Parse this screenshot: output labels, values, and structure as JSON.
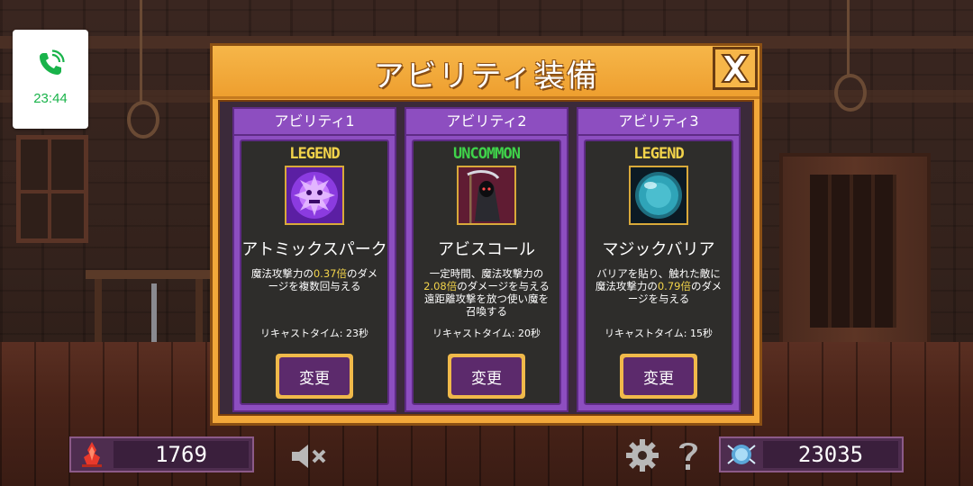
{
  "phone": {
    "time": "23:44",
    "icon": "phone-call-icon",
    "color": "#19b34a"
  },
  "dialog": {
    "title": "アビリティ装備",
    "close_icon": "close-x-icon",
    "slots": [
      {
        "label": "アビリティ1",
        "rarity": "LEGEND",
        "rarity_color": "#f2d34a",
        "icon": "atomic-spark-icon",
        "name": "アトミックスパーク",
        "desc_parts": [
          "魔法攻撃力の",
          "0.37倍",
          "のダメージを複数回与える"
        ],
        "recast": "リキャストタイム: 23秒",
        "button": "変更"
      },
      {
        "label": "アビリティ2",
        "rarity": "UNCOMMON",
        "rarity_color": "#3fd24a",
        "icon": "reaper-icon",
        "name": "アビスコール",
        "desc_parts": [
          "一定時間、魔法攻撃力の",
          "2.08倍",
          "のダメージを与える遠距離攻撃を放つ使い魔を召喚する"
        ],
        "recast": "リキャストタイム: 20秒",
        "button": "変更"
      },
      {
        "label": "アビリティ3",
        "rarity": "LEGEND",
        "rarity_color": "#f2d34a",
        "icon": "magic-barrier-orb-icon",
        "name": "マジックバリア",
        "desc_parts": [
          "バリアを貼り、触れた敵に魔法攻撃力の",
          "0.79倍",
          "のダメージを与える"
        ],
        "recast": "リキャストタイム: 15秒",
        "button": "変更"
      }
    ]
  },
  "hud": {
    "left_counter": {
      "icon": "red-flame-crystal-icon",
      "value": "1769"
    },
    "right_counter": {
      "icon": "blue-gem-orb-icon",
      "value": "23035"
    },
    "mute_icon": "speaker-muted-icon",
    "settings_icon": "gear-icon",
    "help_icon": "question-mark-icon"
  }
}
